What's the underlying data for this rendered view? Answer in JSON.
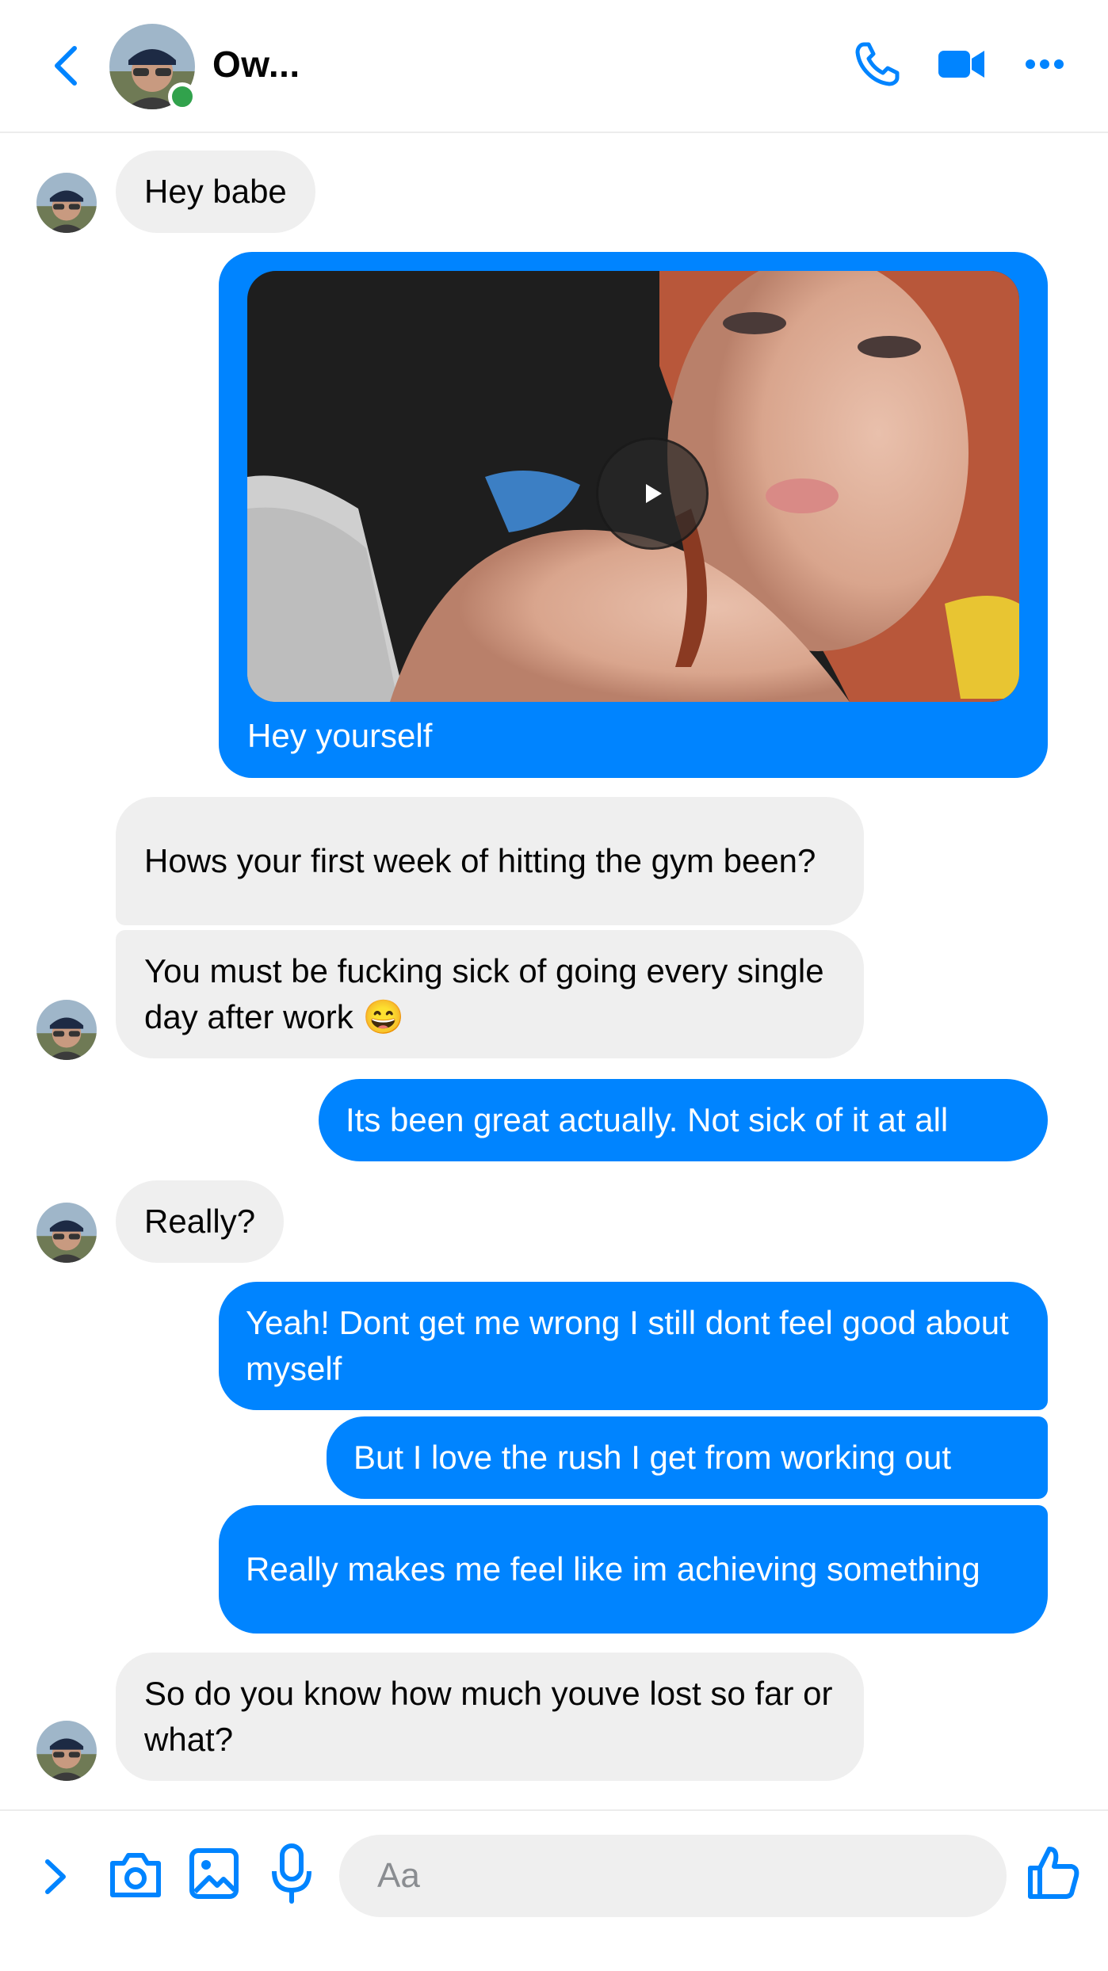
{
  "header": {
    "contact_name": "Ow...",
    "online": true,
    "accent": "#0084ff",
    "icons": [
      "back-icon",
      "phone-icon",
      "video-call-icon",
      "more-icon"
    ]
  },
  "thread": {
    "messages": [
      {
        "from": "them",
        "text": "Hey babe"
      },
      {
        "from": "me",
        "type": "video",
        "caption": "Hey yourself"
      },
      {
        "from": "them",
        "text": "Hows your first week of hitting the gym been?"
      },
      {
        "from": "them",
        "text": "You must be fucking sick of going every single day after work 😄"
      },
      {
        "from": "me",
        "text": "Its been great actually. Not sick of it at all"
      },
      {
        "from": "them",
        "text": "Really?"
      },
      {
        "from": "me",
        "text": "Yeah! Dont get me wrong I still dont feel good about myself"
      },
      {
        "from": "me",
        "text": "But I love the rush I get from working out"
      },
      {
        "from": "me",
        "text": "Really makes me feel like im achieving something"
      },
      {
        "from": "them",
        "text": "So do you know how much youve lost so far or what?"
      }
    ]
  },
  "composer": {
    "placeholder": "Aa",
    "icons": [
      "chevron-right-icon",
      "camera-icon",
      "image-icon",
      "microphone-icon",
      "thumbs-up-icon"
    ]
  },
  "colors": {
    "outgoing": "#0084ff",
    "incoming": "#efefef",
    "online": "#31a24c"
  }
}
